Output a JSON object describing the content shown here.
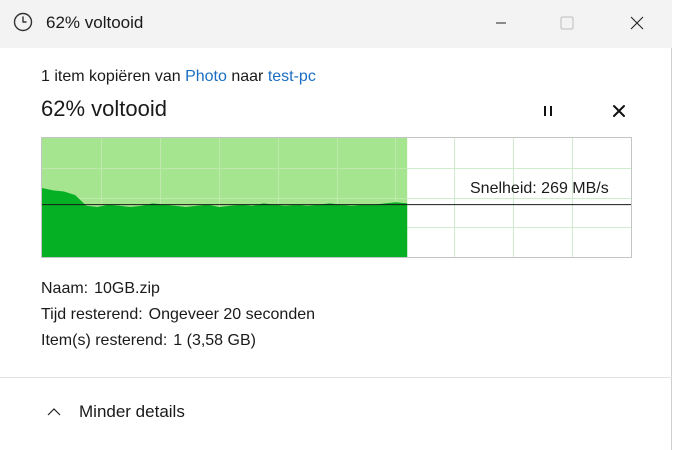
{
  "window": {
    "title": "62% voltooid"
  },
  "transfer": {
    "prefix": "1 item kopiëren van ",
    "source": "Photo",
    "middle": " naar ",
    "destination": "test-pc",
    "heading": "62% voltooid",
    "percent_complete": 62
  },
  "graph": {
    "speed_label": "Snelheid: 269 MB/s",
    "speed_history_relative": [
      0.58,
      0.56,
      0.55,
      0.52,
      0.43,
      0.42,
      0.44,
      0.43,
      0.42,
      0.43,
      0.45,
      0.44,
      0.43,
      0.42,
      0.43,
      0.44,
      0.42,
      0.43,
      0.44,
      0.43,
      0.45,
      0.44,
      0.43,
      0.44,
      0.43,
      0.44,
      0.45,
      0.44,
      0.43,
      0.44,
      0.44,
      0.45,
      0.46,
      0.45
    ],
    "current_speed_relative": 0.44,
    "colors": {
      "done_bg": "#a6e590",
      "done_fill": "#06b025",
      "grid": "#cfeccd",
      "grid_done": "#bfe8ac",
      "speed_line": "#1a1a1a"
    }
  },
  "details": {
    "name_label": "Naam:",
    "name_value": "10GB.zip",
    "time_label": "Tijd resterend:",
    "time_value": "Ongeveer 20 seconden",
    "items_label": "Item(s) resterend:",
    "items_value": "1 (3,58 GB)"
  },
  "footer": {
    "toggle_label": "Minder details"
  },
  "icons": {
    "title": "clock-icon",
    "pause": "pause-icon",
    "cancel": "close-icon",
    "toggle": "chevron-up-icon"
  }
}
